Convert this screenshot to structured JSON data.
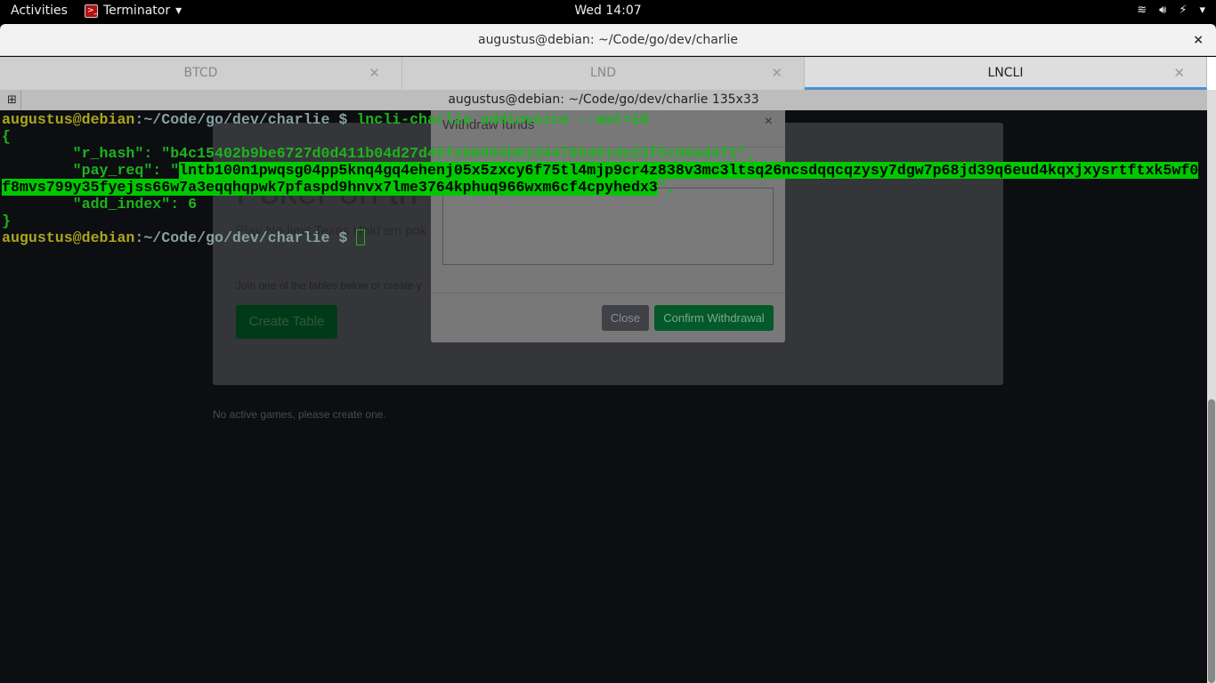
{
  "topbar": {
    "activities": "Activities",
    "app": "Terminator",
    "clock": "Wed 14:07",
    "tray": {
      "wifi": "wifi-icon",
      "volume": "volume-icon",
      "battery": "battery-charging-icon",
      "menu": "▾"
    }
  },
  "window": {
    "title": "augustus@debian: ~/Code/go/dev/charlie",
    "close": "×"
  },
  "tabs": [
    {
      "label": "BTCD",
      "active": false
    },
    {
      "label": "LND",
      "active": false
    },
    {
      "label": "LNCLI",
      "active": true
    }
  ],
  "terminal": {
    "header": "augustus@debian: ~/Code/go/dev/charlie 135x33",
    "prompt_user": "augustus@debian",
    "prompt_path": ":~/Code/go/dev/charlie $ ",
    "command": "lncli-charlie addinvoice --amt=10",
    "open_brace": "{",
    "r_hash_line": "        \"r_hash\": \"b4c15402b9be6727d0d411b04d27d45febb904b81d44789d91de23f5c00ad4f1\",",
    "pay_req_prefix": "        \"pay_req\": \"",
    "pay_req_part1": "lntb100n1pwqsg04pp5knq4gq4ehenj05x5zxcy6f75tl4mjp9cr4z838v3mc3ltsq26ncsdqqcqzysy7dgw7p68jd39q6eud4kqxjxysrtftxk5wf0",
    "pay_req_part2": "f8mvs799y35fyejss66w7a3eqqhqpwk7pfaspd9hnvx7lme3764kphuq966wxm6cf4cpyhedx3",
    "pay_req_suffix": "\",",
    "add_index_line": "        \"add_index\": 6",
    "close_brace": "}"
  },
  "browser": {
    "heading_fragment": "Poker on th",
    "heading_end": "!",
    "subtitle_fragment": "Play No-limit Texas Hold'em pok",
    "join_fragment": "Join one of the tables below or create y",
    "create_table": "Create Table",
    "no_games": "No active games, please create one.",
    "modal": {
      "title": "Withdraw funds",
      "close_x": "×",
      "close": "Close",
      "confirm": "Confirm Withdrawal"
    }
  }
}
